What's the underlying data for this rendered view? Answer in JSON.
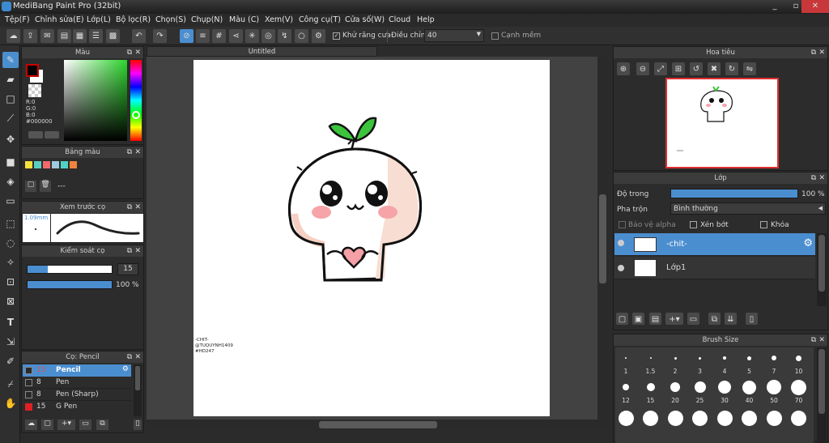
{
  "window": {
    "title": "MediBang Paint Pro (32bit)",
    "min": "_",
    "max": "▫",
    "close": "✕"
  },
  "menu": [
    "Tệp(F)",
    "Chỉnh sửa(E)",
    "Lớp(L)",
    "Bộ lọc(R)",
    "Chọn(S)",
    "Chụp(N)",
    "Màu (C)",
    "Xem(V)",
    "Công cụ(T)",
    "Cửa số(W)",
    "Cloud",
    "Help"
  ],
  "toolbar": {
    "antialias_label": "Khử răng cưa",
    "adjust_label": "Điều chỉnh",
    "adjust_value": "40",
    "edge_label": "Cạnh mềm"
  },
  "color_panel": {
    "title": "Màu",
    "r": "R:0",
    "g": "G:0",
    "b": "B:0",
    "hex": "#000000",
    "primary": "#000000",
    "secondary": "#ffffff"
  },
  "palette_panel": {
    "title": "Bảng màu",
    "swatches": [
      "#f5e23c",
      "#5ccfc2",
      "#f26a6a",
      "#9ec9e0",
      "#51d1c4",
      "#f0843c"
    ],
    "sep": "---"
  },
  "brush_preview": {
    "title": "Xem trước cọ",
    "size": "1.09mm"
  },
  "brush_control": {
    "title": "Kiểm soát cọ",
    "size": "15",
    "opacity": "100 %",
    "size_frac": 0.24,
    "opacity_frac": 1.0
  },
  "brush_panel": {
    "title": "Cọ: Pencil",
    "items": [
      {
        "size": "15",
        "name": "Pencil",
        "color": "#2a2a2a",
        "sel": true
      },
      {
        "size": "8",
        "name": "Pen",
        "color": "#2a2a2a",
        "sel": false
      },
      {
        "size": "8",
        "name": "Pen (Sharp)",
        "color": "#2a2a2a",
        "sel": false
      },
      {
        "size": "15",
        "name": "G Pen",
        "color": "#e02020",
        "sel": false
      }
    ]
  },
  "document": {
    "tab": "Untitled",
    "watermark": [
      "-CHIT-",
      "@TUQUYNH1409",
      "#HD247"
    ]
  },
  "navigator": {
    "title": "Hoa tiêu"
  },
  "layer_panel": {
    "title": "Lớp",
    "opacity_label": "Độ trong",
    "opacity_value": "100 %",
    "opacity_frac": 1.0,
    "blend_label": "Pha trộn",
    "blend_value": "Bình thường",
    "protect_alpha": "Bảo vệ alpha",
    "clipping": "Xén bớt",
    "lock": "Khóa",
    "layers": [
      {
        "name": "-chit-",
        "sel": true
      },
      {
        "name": "Lớp1",
        "sel": false
      }
    ]
  },
  "brush_size": {
    "title": "Brush Size",
    "sizes": [
      "1",
      "1.5",
      "2",
      "3",
      "4",
      "5",
      "7",
      "10",
      "12",
      "15",
      "20",
      "25",
      "30",
      "40",
      "50",
      "70"
    ]
  }
}
